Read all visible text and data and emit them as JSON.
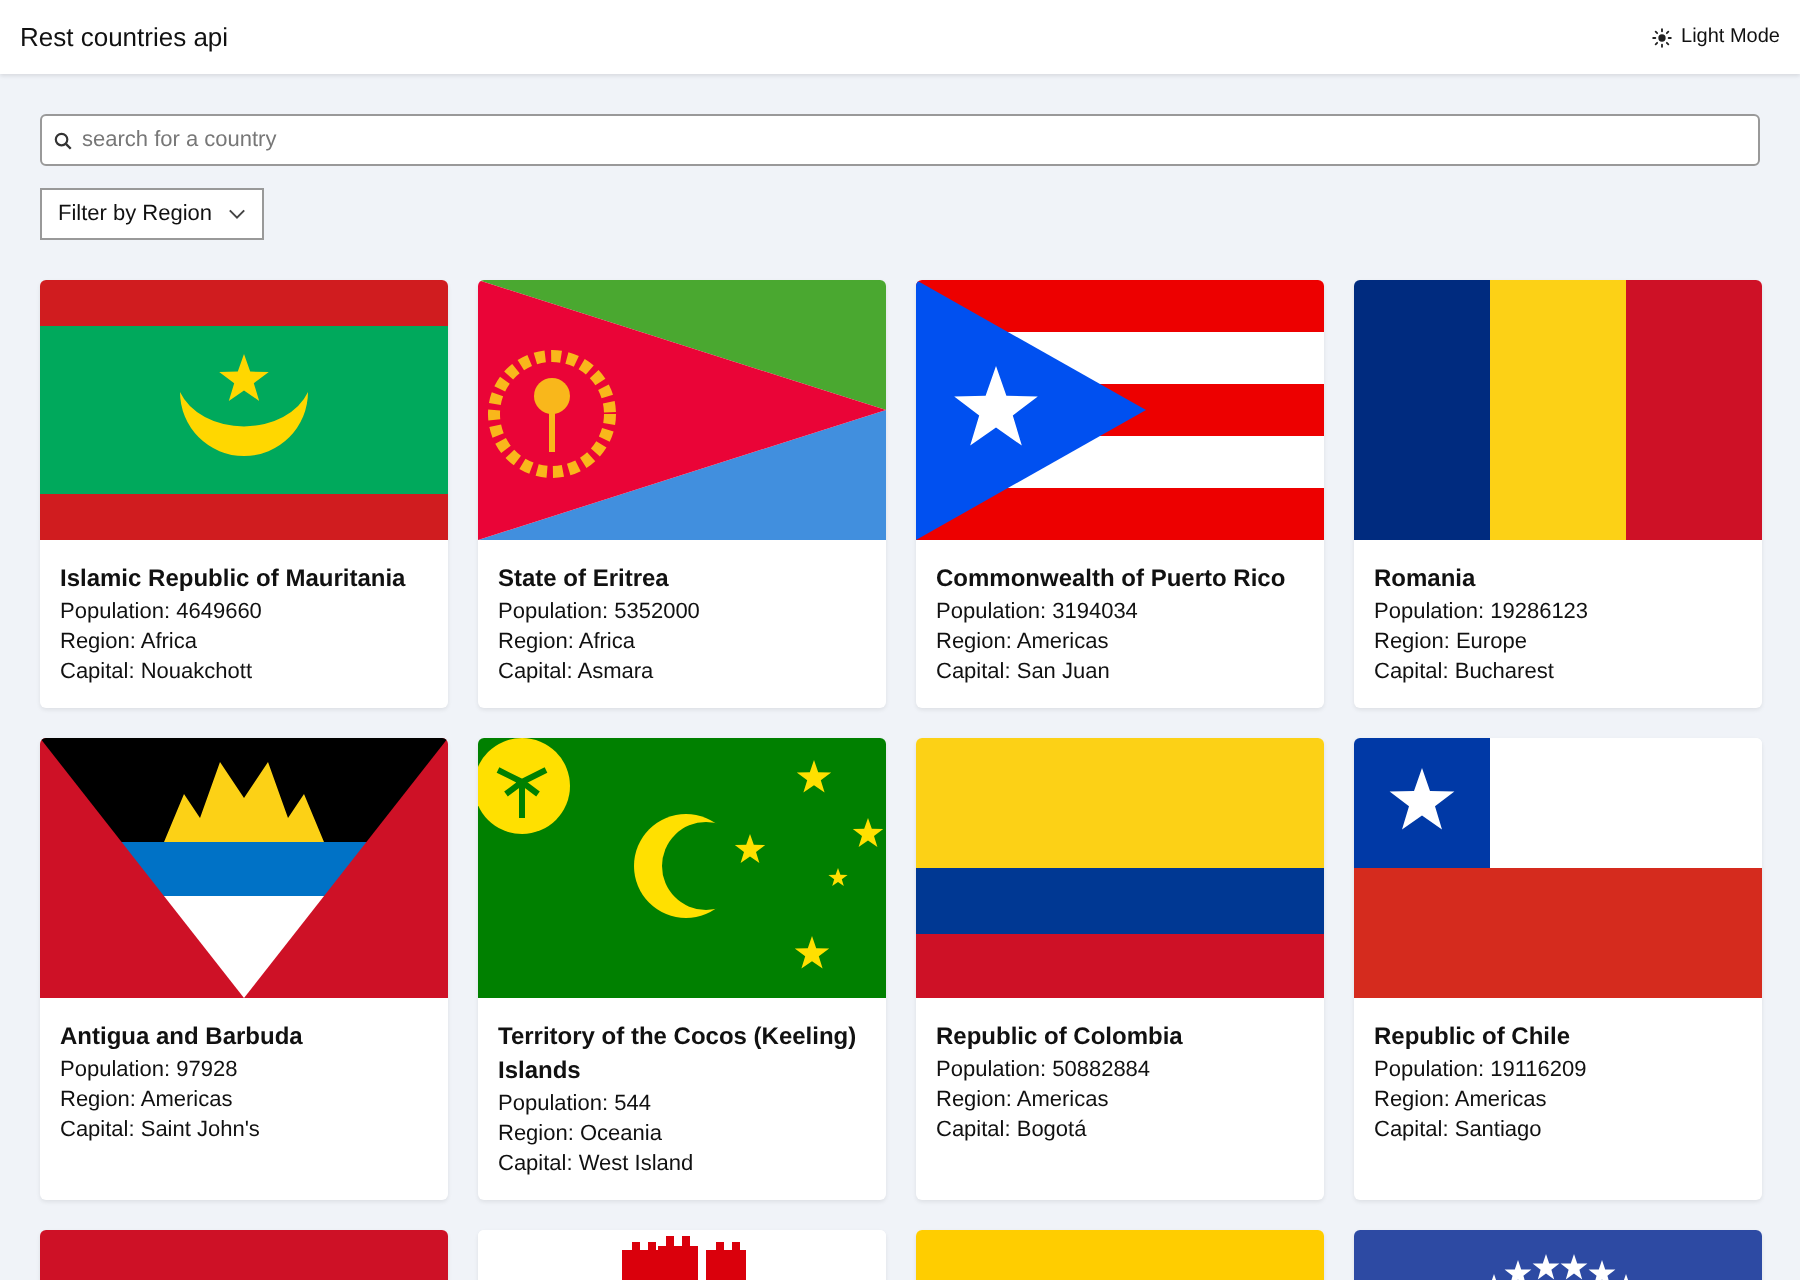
{
  "header": {
    "title": "Rest countries api",
    "theme_toggle": "Light Mode"
  },
  "search": {
    "placeholder": "search for a country"
  },
  "filter": {
    "label": "Filter by Region"
  },
  "countries": [
    {
      "kind": "mauritania",
      "name": "Islamic Republic of Mauritania",
      "population": "Population: 4649660",
      "region": "Region: Africa",
      "capital": "Capital: Nouakchott"
    },
    {
      "kind": "eritrea",
      "name": "State of Eritrea",
      "population": "Population: 5352000",
      "region": "Region: Africa",
      "capital": "Capital: Asmara"
    },
    {
      "kind": "puerto_rico",
      "name": "Commonwealth of Puerto Rico",
      "population": "Population: 3194034",
      "region": "Region: Americas",
      "capital": "Capital: San Juan"
    },
    {
      "kind": "romania",
      "name": "Romania",
      "population": "Population: 19286123",
      "region": "Region: Europe",
      "capital": "Capital: Bucharest"
    },
    {
      "kind": "antigua",
      "name": "Antigua and Barbuda",
      "population": "Population: 97928",
      "region": "Region: Americas",
      "capital": "Capital: Saint John's"
    },
    {
      "kind": "cocos",
      "name": "Territory of the Cocos (Keeling) Islands",
      "population": "Population: 544",
      "region": "Region: Oceania",
      "capital": "Capital: West Island"
    },
    {
      "kind": "colombia",
      "name": "Republic of Colombia",
      "population": "Population: 50882884",
      "region": "Region: Americas",
      "capital": "Capital: Bogotá"
    },
    {
      "kind": "chile",
      "name": "Republic of Chile",
      "population": "Population: 19116209",
      "region": "Region: Americas",
      "capital": "Capital: Santiago"
    },
    {
      "kind": "red"
    },
    {
      "kind": "castle"
    },
    {
      "kind": "yellow"
    },
    {
      "kind": "blue_stars"
    }
  ]
}
